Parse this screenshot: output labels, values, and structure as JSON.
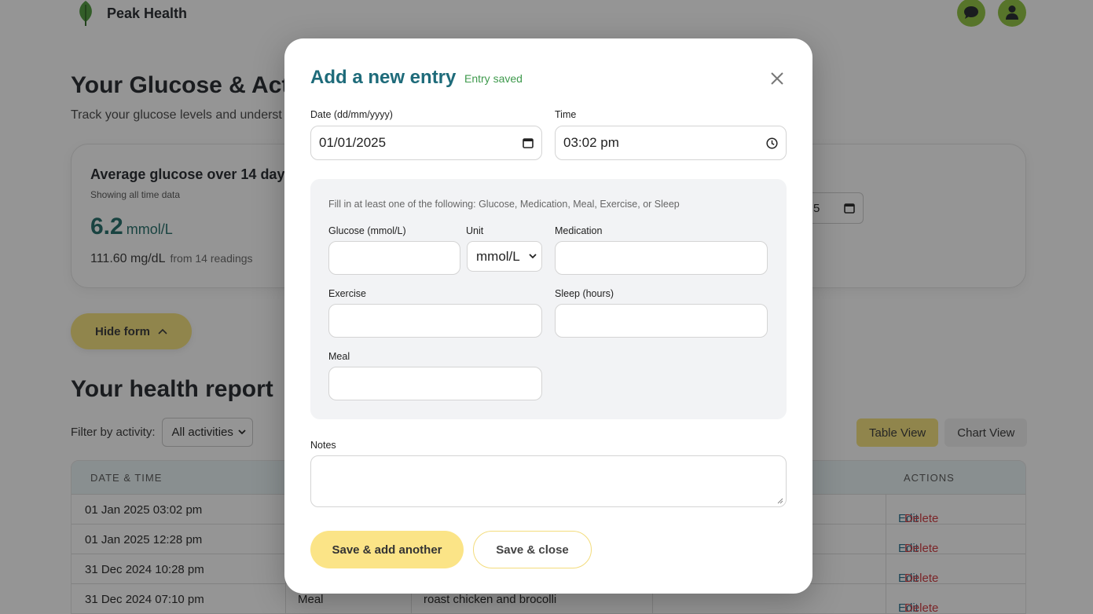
{
  "header": {
    "brand": "Peak Health",
    "icons": {
      "logo": "leaf-icon",
      "chat": "chat-icon",
      "user": "user-icon"
    },
    "accent_color": "#8fc43c"
  },
  "page": {
    "title": "Your Glucose & Acti",
    "subtitle": "Track your glucose levels and underst"
  },
  "stats": {
    "title": "Average glucose over 14 days",
    "note": "Showing all time data",
    "value": "6.2",
    "unit": "mmol/L",
    "mg_value": "111.60 mg/dL",
    "from_text": "from 14 readings",
    "date_peek": "5"
  },
  "hide_form": {
    "label": "Hide form"
  },
  "report": {
    "title": "Your health report",
    "filter_label": "Filter by activity:",
    "filter_value": "All activities",
    "tabs": [
      {
        "label": "Table View",
        "active": true
      },
      {
        "label": "Chart View",
        "active": false
      }
    ],
    "columns": {
      "date_time": "DATE & TIME",
      "actions": "ACTIONS"
    },
    "rows": [
      {
        "date_time": "01 Jan 2025 03:02 pm",
        "type": "",
        "details": "",
        "edit": "Edit",
        "delete": "Delete"
      },
      {
        "date_time": "01 Jan 2025 12:28 pm",
        "type": "",
        "details": "",
        "edit": "Edit",
        "delete": "Delete"
      },
      {
        "date_time": "31 Dec 2024 10:28 pm",
        "type": "",
        "details": "",
        "edit": "Edit",
        "delete": "Delete"
      },
      {
        "date_time": "31 Dec 2024 07:10 pm",
        "type": "Meal",
        "details": "roast chicken and brocolli",
        "edit": "Edit",
        "delete": "Delete"
      }
    ]
  },
  "modal": {
    "title": "Add a new entry",
    "status": "Entry saved",
    "date_label": "Date (dd/mm/yyyy)",
    "date_value": "01/01/2025",
    "time_label": "Time",
    "time_value": "03:02 pm",
    "hint": "Fill in at least one of the following: Glucose, Medication, Meal, Exercise, or Sleep",
    "glucose_label": "Glucose (mmol/L)",
    "glucose_value": "",
    "unit_label": "Unit",
    "unit_value": "mmol/L",
    "medication_label": "Medication",
    "medication_value": "",
    "exercise_label": "Exercise",
    "exercise_value": "",
    "sleep_label": "Sleep (hours)",
    "sleep_value": "",
    "meal_label": "Meal",
    "meal_value": "",
    "notes_label": "Notes",
    "notes_value": "",
    "save_add_label": "Save & add another",
    "save_close_label": "Save & close"
  }
}
